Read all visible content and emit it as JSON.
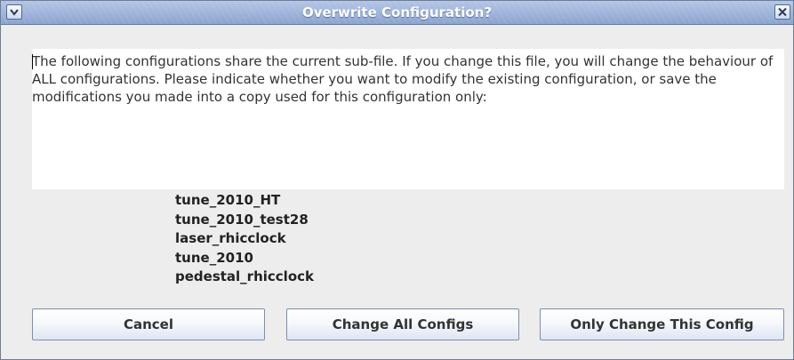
{
  "window": {
    "title": "Overwrite Configuration?",
    "menu_icon": "chevron-down-icon",
    "close_icon": "close-icon"
  },
  "message": "The following configurations share the current sub-file.  If you change this file, you will change the behaviour of ALL configurations.   Please indicate whether you want to modify the existing configuration, or save the modifications you made into a copy used for this configuration only:",
  "configurations": [
    "tune_2010_HT",
    "tune_2010_test28",
    "laser_rhicclock",
    "tune_2010",
    "pedestal_rhicclock"
  ],
  "buttons": {
    "cancel": "Cancel",
    "change_all": "Change All Configs",
    "only_this": "Only Change This Config"
  },
  "colors": {
    "titlebar": "#8fa8d3",
    "dialog_background": "#ededed",
    "button_border": "#7d8fac"
  }
}
